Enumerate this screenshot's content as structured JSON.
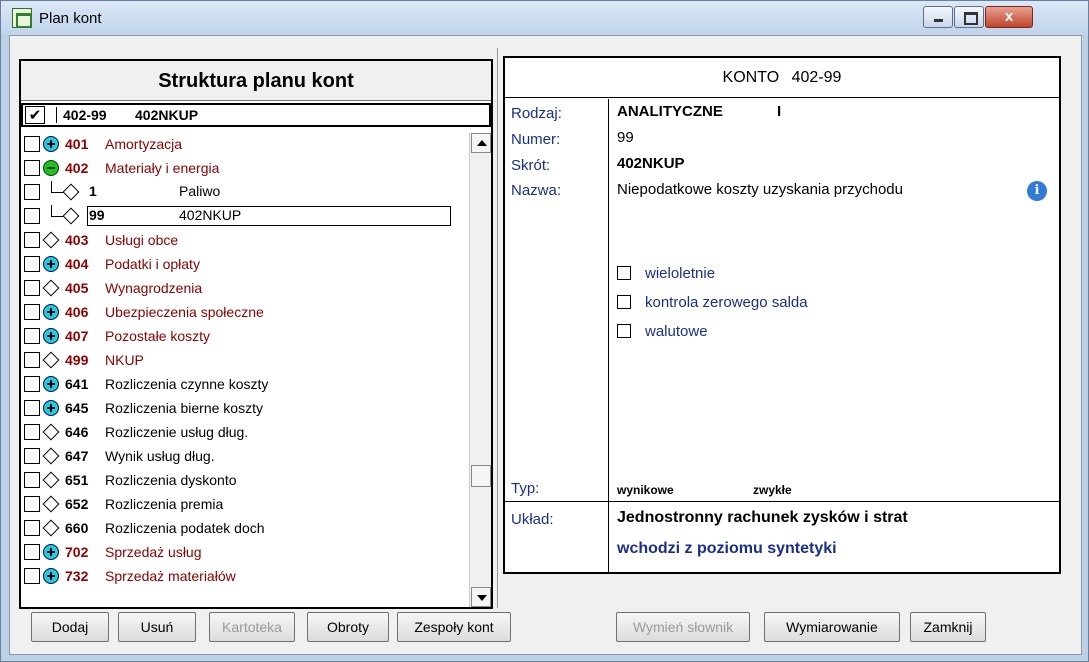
{
  "window": {
    "title": "Plan kont",
    "close_label": "x"
  },
  "left": {
    "header": "Struktura planu kont",
    "selected": {
      "check": "✔",
      "code": "402-99",
      "name": "402NKUP"
    },
    "tree": [
      {
        "code": "401",
        "name": "Amortyzacja",
        "node": "plus",
        "color": "red"
      },
      {
        "code": "402",
        "name": "Materiały i energia",
        "node": "minus",
        "color": "red"
      },
      {
        "code": "1",
        "name": "Paliwo",
        "node": "child"
      },
      {
        "code": "99",
        "name": "402NKUP",
        "node": "child-selected"
      },
      {
        "code": "403",
        "name": "Usługi obce",
        "node": "diamond",
        "color": "red"
      },
      {
        "code": "404",
        "name": "Podatki i opłaty",
        "node": "plus",
        "color": "red"
      },
      {
        "code": "405",
        "name": "Wynagrodzenia",
        "node": "diamond",
        "color": "red"
      },
      {
        "code": "406",
        "name": "Ubezpieczenia społeczne",
        "node": "plus",
        "color": "red"
      },
      {
        "code": "407",
        "name": "Pozostałe koszty",
        "node": "plus",
        "color": "red"
      },
      {
        "code": "499",
        "name": "NKUP",
        "node": "diamond",
        "color": "red"
      },
      {
        "code": "641",
        "name": "Rozliczenia czynne koszty",
        "node": "plus",
        "color": "black"
      },
      {
        "code": "645",
        "name": "Rozliczenia bierne koszty",
        "node": "plus",
        "color": "black"
      },
      {
        "code": "646",
        "name": "Rozliczenie usług dług.",
        "node": "diamond",
        "color": "black"
      },
      {
        "code": "647",
        "name": "Wynik usług dług.",
        "node": "diamond",
        "color": "black"
      },
      {
        "code": "651",
        "name": "Rozliczenia dyskonto",
        "node": "diamond",
        "color": "black"
      },
      {
        "code": "652",
        "name": "Rozliczenia premia",
        "node": "diamond",
        "color": "black"
      },
      {
        "code": "660",
        "name": "Rozliczenia podatek doch",
        "node": "diamond",
        "color": "black"
      },
      {
        "code": "702",
        "name": "Sprzedaż usług",
        "node": "plus",
        "color": "red"
      },
      {
        "code": "732",
        "name": "Sprzedaż materiałów",
        "node": "plus",
        "color": "red"
      }
    ]
  },
  "right": {
    "header_prefix": "KONTO",
    "header_code": "402-99",
    "labels": {
      "rodzaj": "Rodzaj:",
      "numer": "Numer:",
      "skrot": "Skrót:",
      "nazwa": "Nazwa:",
      "typ": "Typ:",
      "uklad": "Układ:"
    },
    "values": {
      "rodzaj": "ANALITYCZNE",
      "rodzaj_level": "I",
      "numer": "99",
      "skrot": "402NKUP",
      "nazwa": "Niepodatkowe koszty uzyskania przychodu",
      "typ1": "wynikowe",
      "typ2": "zwykłe",
      "uklad1": "Jednostronny rachunek zysków i strat",
      "uklad2": "wchodzi z poziomu syntetyki"
    },
    "flags": [
      "wieloletnie",
      "kontrola zerowego salda",
      "walutowe"
    ],
    "info_icon": "i"
  },
  "buttons": {
    "dodaj": "Dodaj",
    "usun": "Usuń",
    "kartoteka": "Kartoteka",
    "obroty": "Obroty",
    "zespoly": "Zespoły kont",
    "wymien": "Wymień słownik",
    "wymiarowanie": "Wymiarowanie",
    "zamknij": "Zamknij"
  },
  "colors": {
    "red_text": "#8b0000",
    "label_blue": "#1a2e8c",
    "uklad2_blue": "#1a2e8c"
  }
}
